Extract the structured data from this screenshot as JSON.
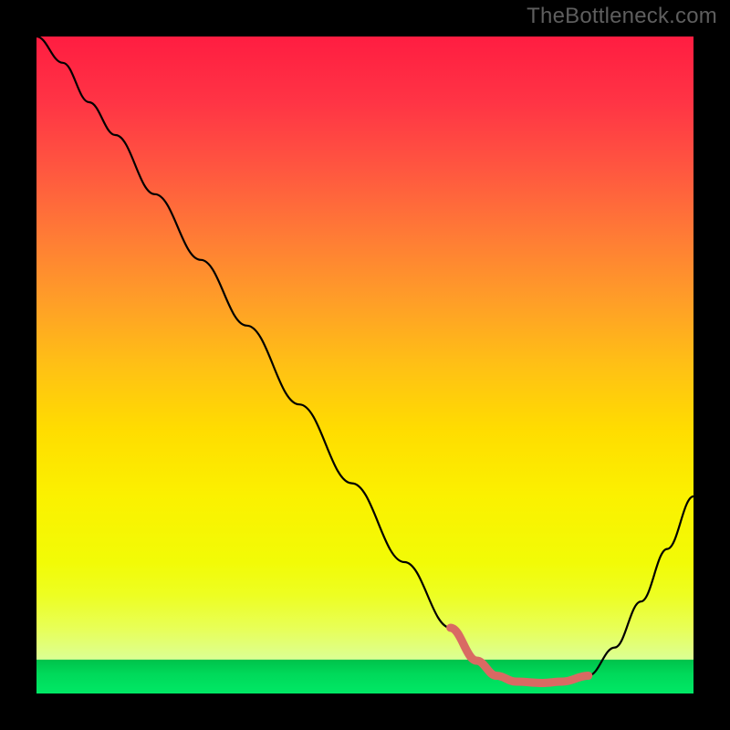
{
  "watermark": "TheBottleneck.com",
  "colors": {
    "gradient_stops": [
      {
        "offset": 0.0,
        "color": "#ff1d41"
      },
      {
        "offset": 0.1,
        "color": "#ff3445"
      },
      {
        "offset": 0.2,
        "color": "#ff5640"
      },
      {
        "offset": 0.3,
        "color": "#ff7a36"
      },
      {
        "offset": 0.4,
        "color": "#ff9d28"
      },
      {
        "offset": 0.5,
        "color": "#ffc015"
      },
      {
        "offset": 0.6,
        "color": "#ffdd00"
      },
      {
        "offset": 0.7,
        "color": "#fbf100"
      },
      {
        "offset": 0.8,
        "color": "#f2fb06"
      },
      {
        "offset": 0.85,
        "color": "#edfe22"
      },
      {
        "offset": 0.9,
        "color": "#e8ff56"
      },
      {
        "offset": 0.948,
        "color": "#dcff94"
      },
      {
        "offset": 0.949,
        "color": "#00c24b"
      },
      {
        "offset": 0.97,
        "color": "#00d95a"
      },
      {
        "offset": 1.0,
        "color": "#00e865"
      }
    ],
    "curve": "#000000",
    "highlight": "#d96a63"
  },
  "chart_data": {
    "type": "line",
    "x": [
      0.0,
      0.04,
      0.08,
      0.12,
      0.18,
      0.25,
      0.32,
      0.4,
      0.48,
      0.56,
      0.63,
      0.67,
      0.7,
      0.73,
      0.77,
      0.8,
      0.84,
      0.88,
      0.92,
      0.96,
      1.0
    ],
    "series": [
      {
        "name": "bottleneck-curve",
        "values": [
          1.0,
          0.96,
          0.9,
          0.85,
          0.76,
          0.66,
          0.56,
          0.44,
          0.32,
          0.2,
          0.1,
          0.05,
          0.027,
          0.018,
          0.016,
          0.018,
          0.027,
          0.07,
          0.14,
          0.22,
          0.3
        ]
      }
    ],
    "highlight_range_x": [
      0.63,
      0.84
    ],
    "xlim": [
      0,
      1
    ],
    "ylim": [
      0,
      1
    ],
    "title": "",
    "xlabel": "",
    "ylabel": ""
  }
}
